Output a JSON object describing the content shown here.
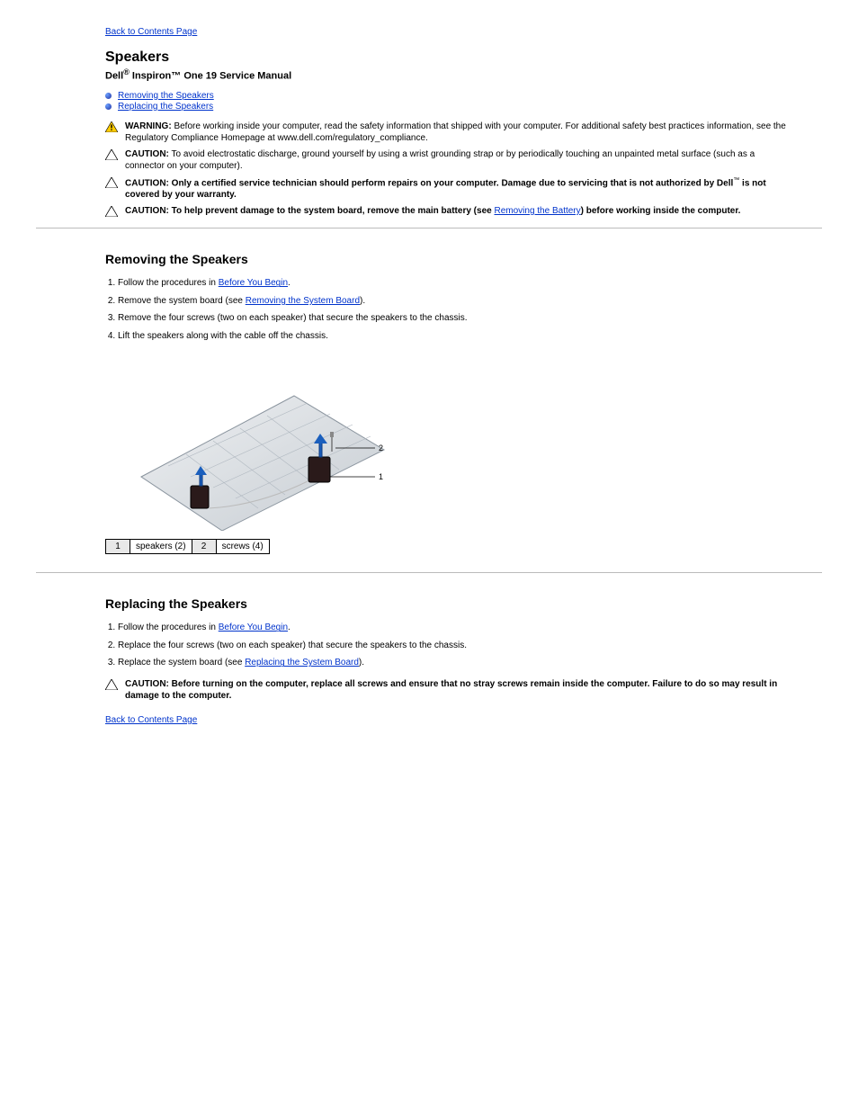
{
  "nav": {
    "back_label": "Back to Contents Page"
  },
  "header": {
    "title": "Speakers",
    "subtitle_prefix": "Dell",
    "subtitle_model": " Inspiron™ One 19 Service Manual"
  },
  "toc": [
    {
      "label": "Removing the Speakers"
    },
    {
      "label": "Replacing the Speakers"
    }
  ],
  "callouts": {
    "warning": {
      "label": "WARNING:",
      "text": " Before working inside your computer, read the safety information that shipped with your computer. For additional safety best practices information, see the Regulatory Compliance Homepage at www.dell.com/regulatory_compliance."
    },
    "caution_esd": {
      "label": "CAUTION:",
      "text": " To avoid electrostatic discharge, ground yourself by using a wrist grounding strap or by periodically touching an unpainted metal surface (such as a connector on your computer)."
    },
    "caution_auth": {
      "label": "CAUTION:",
      "text_pre": " Only a certified service technician should perform repairs on your computer. Damage due to servicing that is not authorized by Dell",
      "tm": "™",
      "text_post": " is not covered by your warranty."
    },
    "caution_battery": {
      "label": "CAUTION:",
      "text_pre": " To help prevent damage to the system board, remove the main battery (see ",
      "link": "Removing the Battery",
      "text_post": ") before working inside the computer."
    },
    "caution_power": {
      "label": "CAUTION:",
      "text": " Before turning on the computer, replace all screws and ensure that no stray screws remain inside the computer. Failure to do so may result in damage to the computer."
    }
  },
  "sections": {
    "remove": {
      "title": "Removing the Speakers",
      "steps": [
        {
          "pre": "Follow the procedures in ",
          "link": "Before You Begin",
          "post": "."
        },
        {
          "pre": "Remove the system board (see ",
          "link": "Removing the System Board",
          "post": ")."
        },
        {
          "plain": "Remove the four screws (two on each speaker) that secure the speakers to the chassis."
        },
        {
          "plain": "Lift the speakers along with the cable off the chassis."
        }
      ]
    },
    "replace": {
      "title": "Replacing the Speakers",
      "steps": [
        {
          "pre": "Follow the procedures in ",
          "link": "Before You Begin",
          "post": "."
        },
        {
          "plain": "Replace the four screws (two on each speaker) that secure the speakers to the chassis."
        },
        {
          "pre": "Replace the system board (see ",
          "link": "Replacing the System Board",
          "post": ")."
        }
      ]
    }
  },
  "figure": {
    "labels": {
      "n1": "1",
      "l1": "speakers (2)",
      "n2": "2",
      "l2": "screws (4)"
    },
    "callout1": "1",
    "callout2": "2"
  }
}
